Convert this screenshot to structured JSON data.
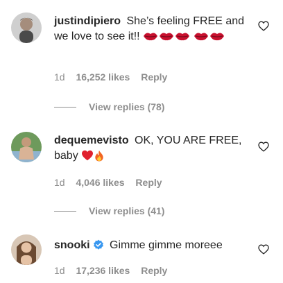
{
  "comments": [
    {
      "username": "justindipiero",
      "text": "She’s feeling FREE and we love to see it!!",
      "emojis": [
        "lips-emoji",
        "lips-emoji",
        "lips-emoji",
        "lips-emoji",
        "lips-emoji"
      ],
      "time": "1d",
      "likes": "16,252 likes",
      "reply": "Reply",
      "view_replies": "View replies (78)"
    },
    {
      "username": "dequemevisto",
      "text": "OK, YOU ARE FREE, baby",
      "emojis": [
        "red-heart-emoji",
        "fire-emoji"
      ],
      "time": "1d",
      "likes": "4,046 likes",
      "reply": "Reply",
      "view_replies": "View replies (41)"
    },
    {
      "username": "snooki",
      "verified": true,
      "text": "Gimme gimme moreee",
      "time": "1d",
      "likes": "17,236 likes",
      "reply": "Reply"
    }
  ],
  "colors": {
    "text": "#262626",
    "meta": "#8e8e8e",
    "verified": "#3897f0",
    "lips": "#c8102e"
  }
}
